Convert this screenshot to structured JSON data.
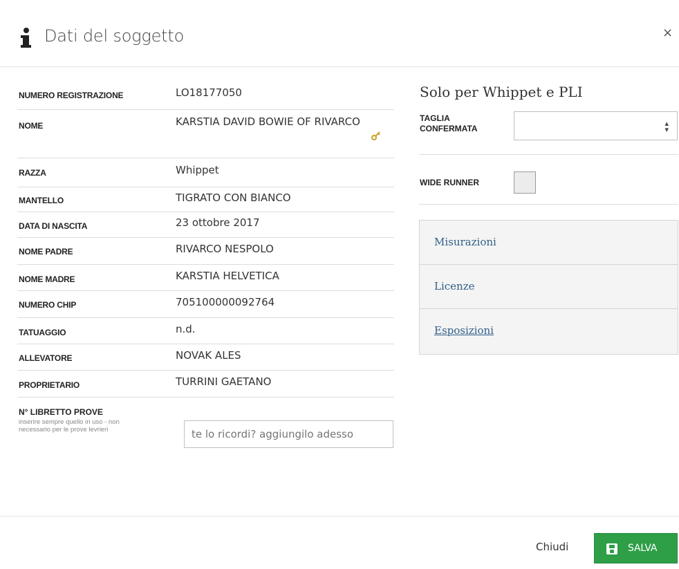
{
  "header": {
    "title": "Dati del soggetto",
    "close": "×",
    "icon": "info-icon"
  },
  "details": {
    "rows": [
      {
        "label": "NUMERO REGISTRAZIONE",
        "value": "LO18177050"
      },
      {
        "label": "NOME",
        "value": "KARSTIA DAVID BOWIE OF RIVARCO",
        "icon": "key-icon"
      },
      {
        "label": "RAZZA",
        "value": "Whippet"
      },
      {
        "label": "MANTELLO",
        "value": "TIGRATO CON BIANCO"
      },
      {
        "label": "DATA DI NASCITA",
        "value": "23 ottobre 2017"
      },
      {
        "label": "NOME PADRE",
        "value": "RIVARCO NESPOLO"
      },
      {
        "label": "NOME MADRE",
        "value": "KARSTIA HELVETICA"
      },
      {
        "label": "NUMERO CHIP",
        "value": "705100000092764"
      },
      {
        "label": "TATUAGGIO",
        "value": "n.d."
      },
      {
        "label": "ALLEVATORE",
        "value": "NOVAK ALES"
      },
      {
        "label": "PROPRIETARIO",
        "value": "TURRINI GAETANO"
      }
    ],
    "libretto": {
      "label": "N° LIBRETTO PROVE",
      "help": "inserire sempre quello in uso - non necessario per le prove levrieri",
      "placeholder": "te lo ricordi? aggiungilo adesso"
    }
  },
  "right": {
    "section_title": "Solo per Whippet e PLI",
    "taglia_label": "TAGLIA CONFERMATA",
    "taglia_value": "",
    "wide_runner_label": "WIDE RUNNER",
    "wide_runner_checked": false,
    "accordion": [
      {
        "label": "Misurazioni"
      },
      {
        "label": "Licenze"
      },
      {
        "label": "Esposizioni"
      }
    ]
  },
  "footer": {
    "close_label": "Chiudi",
    "save_label": "SALVA",
    "save_color": "#2e9e47"
  }
}
